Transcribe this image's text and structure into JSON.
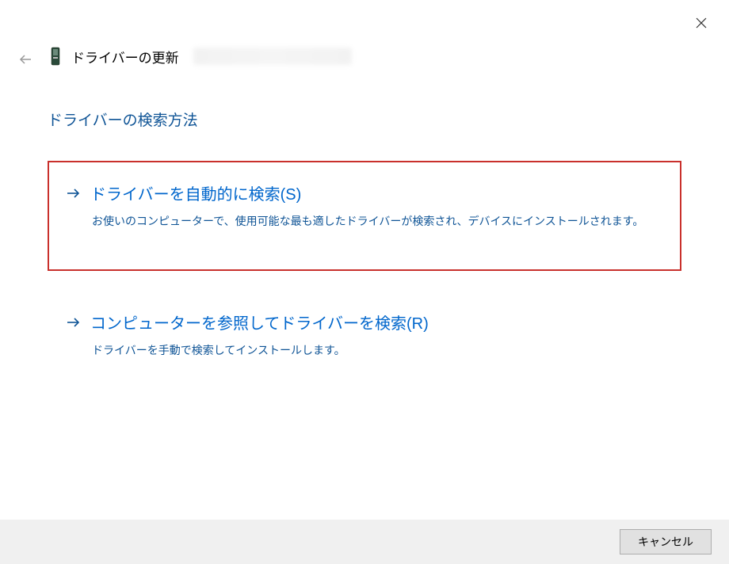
{
  "header": {
    "title": "ドライバーの更新"
  },
  "section_title": "ドライバーの検索方法",
  "options": [
    {
      "title": "ドライバーを自動的に検索(S)",
      "description": "お使いのコンピューターで、使用可能な最も適したドライバーが検索され、デバイスにインストールされます。"
    },
    {
      "title": "コンピューターを参照してドライバーを検索(R)",
      "description": "ドライバーを手動で検索してインストールします。"
    }
  ],
  "footer": {
    "cancel_label": "キャンセル"
  }
}
